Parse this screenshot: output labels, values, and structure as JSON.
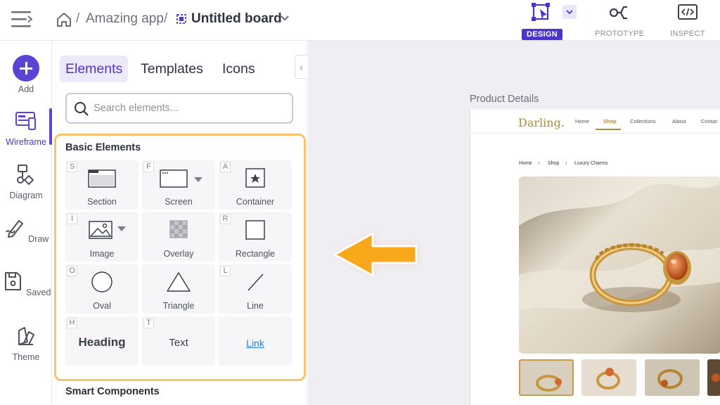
{
  "header": {
    "breadcrumb_app": "Amazing app",
    "separator": "/",
    "board_title": "Untitled board",
    "modes": [
      {
        "label": "DESIGN",
        "icon": "design-mode-icon",
        "active": true
      },
      {
        "label": "PROTOTYPE",
        "icon": "prototype-icon",
        "active": false
      },
      {
        "label": "INSPECT",
        "icon": "inspect-code-icon",
        "active": false
      }
    ]
  },
  "rail": {
    "items": [
      {
        "label": "Add",
        "icon": "plus-icon"
      },
      {
        "label": "Wireframe",
        "icon": "wireframe-icon",
        "active": true
      },
      {
        "label": "Diagram",
        "icon": "diagram-icon"
      },
      {
        "label": "Draw",
        "icon": "pen-icon"
      },
      {
        "label": "Saved",
        "icon": "saved-icon"
      },
      {
        "label": "Theme",
        "icon": "theme-swatch-icon"
      }
    ]
  },
  "panel": {
    "tabs": [
      {
        "label": "Elements",
        "active": true
      },
      {
        "label": "Templates"
      },
      {
        "label": "Icons"
      }
    ],
    "search_placeholder": "Search elements...",
    "basic_title": "Basic Elements",
    "smart_title": "Smart Components",
    "elements": [
      {
        "key": "S",
        "label": "Section"
      },
      {
        "key": "F",
        "label": "Screen"
      },
      {
        "key": "A",
        "label": "Container"
      },
      {
        "key": "I",
        "label": "Image"
      },
      {
        "key": "",
        "label": "Overlay"
      },
      {
        "key": "R",
        "label": "Rectangle"
      },
      {
        "key": "O",
        "label": "Oval"
      },
      {
        "key": "",
        "label": "Triangle"
      },
      {
        "key": "L",
        "label": "Line"
      },
      {
        "key": "H",
        "label": "Heading"
      },
      {
        "key": "T",
        "label": "Text"
      },
      {
        "key": "",
        "label": "Link"
      }
    ]
  },
  "canvas": {
    "frame_title": "Product Details",
    "site": {
      "logo": "Darling.",
      "nav": [
        "Home",
        "Shop",
        "Collections",
        "About",
        "Contac"
      ],
      "active_nav": "Shop",
      "breadcrumb": [
        "Home",
        "Shop",
        "Luxury Charms"
      ]
    }
  },
  "colors": {
    "accent": "#4b36c8",
    "highlight_border": "#f7c46b",
    "arrow": "#f7a81b",
    "brand_gold": "#b48a3c"
  }
}
